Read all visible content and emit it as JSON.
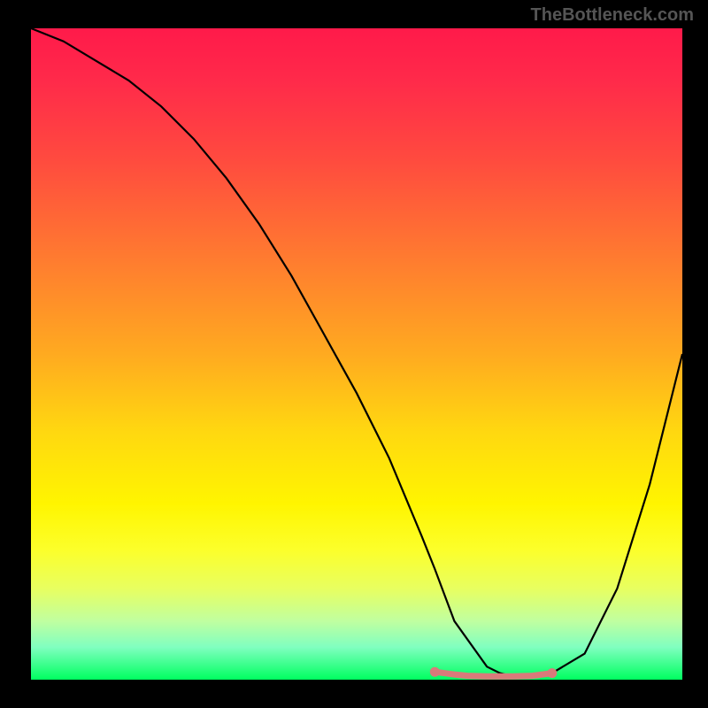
{
  "watermark": "TheBottleneck.com",
  "chart_data": {
    "type": "line",
    "title": "",
    "xlabel": "",
    "ylabel": "",
    "xlim": [
      0,
      100
    ],
    "ylim": [
      0,
      100
    ],
    "series": [
      {
        "name": "bottleneck-curve",
        "x": [
          0,
          5,
          10,
          15,
          20,
          25,
          30,
          35,
          40,
          45,
          50,
          55,
          60,
          62,
          65,
          70,
          72,
          74,
          77,
          80,
          85,
          90,
          95,
          100
        ],
        "values": [
          100,
          98,
          95,
          92,
          88,
          83,
          77,
          70,
          62,
          53,
          44,
          34,
          22,
          17,
          9,
          2,
          1,
          0.5,
          0.5,
          1,
          4,
          14,
          30,
          50
        ]
      },
      {
        "name": "optimal-range-markers",
        "x": [
          62,
          65,
          67,
          70,
          72,
          74,
          77,
          80
        ],
        "values": [
          1.2,
          0.8,
          0.6,
          0.5,
          0.5,
          0.5,
          0.6,
          1.0
        ]
      }
    ],
    "gradient_stops": [
      {
        "pos": 0,
        "color": "#ff1a4a"
      },
      {
        "pos": 20,
        "color": "#ff4a3f"
      },
      {
        "pos": 50,
        "color": "#ffaa20"
      },
      {
        "pos": 73,
        "color": "#fff500"
      },
      {
        "pos": 91,
        "color": "#c0ffa0"
      },
      {
        "pos": 100,
        "color": "#00ff60"
      }
    ],
    "optimal_marker_color": "#d97a7a"
  }
}
